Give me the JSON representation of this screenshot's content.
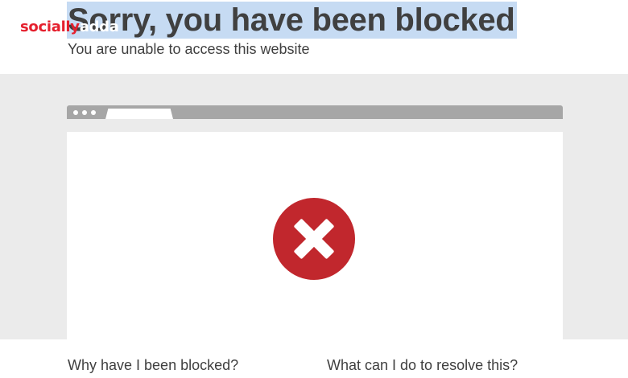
{
  "header": {
    "title": "Sorry, you have been blocked",
    "subtitle": "You are unable to access this website"
  },
  "watermark": {
    "part1": "socially",
    "part2": "adda"
  },
  "colors": {
    "error_red": "#c1272d",
    "highlight": "#c6dbf3",
    "brand_red": "#e5202e"
  },
  "illustration": {
    "icon": "error-x-icon"
  },
  "sections": {
    "why_blocked": "Why have I been blocked?",
    "resolve": "What can I do to resolve this?"
  }
}
